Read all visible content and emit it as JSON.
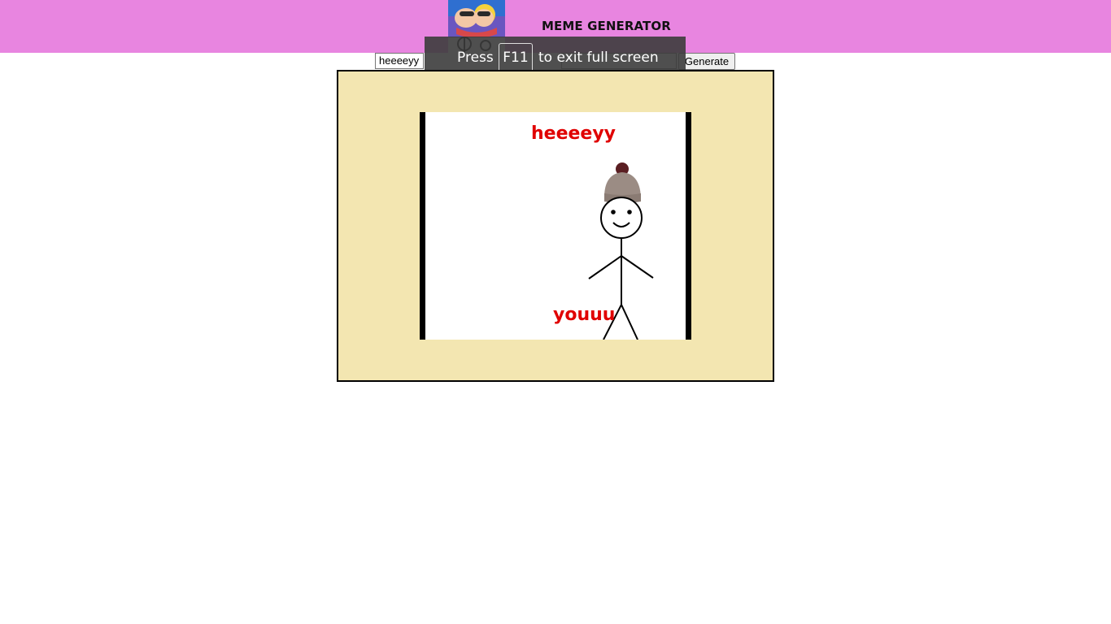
{
  "header": {
    "title": "MEME GENERATOR",
    "background": "#e885e0",
    "logo_icon": "cartoon-logo"
  },
  "form": {
    "top_text_value": "heeeeyy",
    "bottom_text_value": "",
    "generate_label": "Generate"
  },
  "fullscreen_toast": {
    "press": "Press",
    "key": "F11",
    "rest": "to exit full screen"
  },
  "meme": {
    "top_text": "heeeeyy",
    "bottom_text": "youuu",
    "text_color": "#e00000",
    "frame_background": "#f3e6b1",
    "image_icon": "be-like-bill-stick-figure"
  }
}
